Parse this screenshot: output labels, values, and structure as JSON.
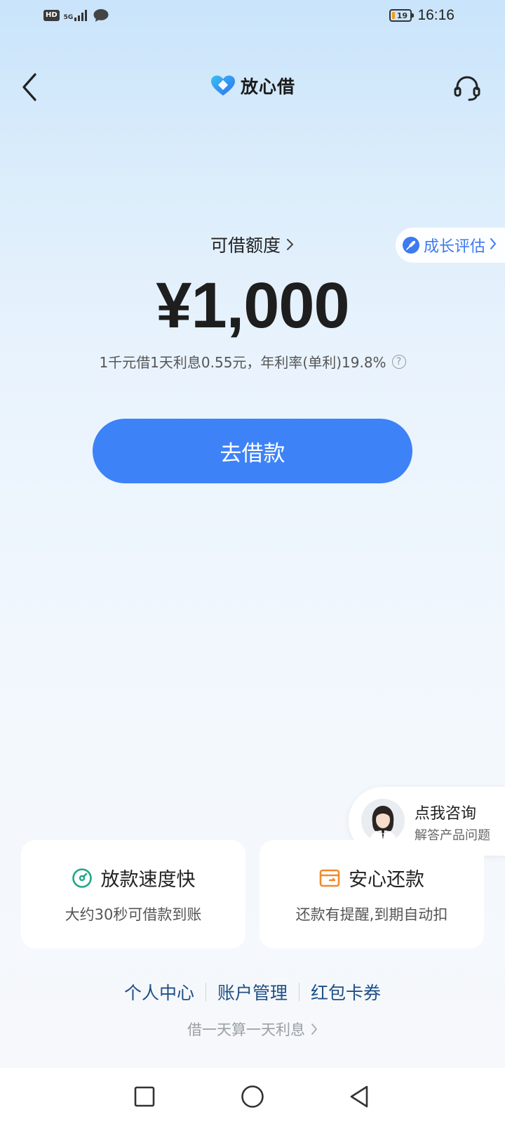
{
  "status_bar": {
    "hd": "HD",
    "network": "5G",
    "battery": "19",
    "time": "16:16"
  },
  "header": {
    "brand": "放心借"
  },
  "growth": {
    "label": "成长评估"
  },
  "limit": {
    "title": "可借额度",
    "amount": "¥1,000",
    "rate_text": "1千元借1天利息0.55元，年利率(单利)19.8%"
  },
  "borrow_button": {
    "label": "去借款"
  },
  "consult": {
    "title": "点我咨询",
    "subtitle": "解答产品问题"
  },
  "features": [
    {
      "title": "放款速度快",
      "desc": "大约30秒可借款到账",
      "color": "#1fa889"
    },
    {
      "title": "安心还款",
      "desc": "还款有提醒,到期自动扣",
      "color": "#f08a2c"
    }
  ],
  "links": {
    "personal": "个人中心",
    "account": "账户管理",
    "coupons": "红包卡券"
  },
  "footer_note": "借一天算一天利息",
  "colors": {
    "accent": "#3d82f7",
    "link": "#1f4f86"
  }
}
